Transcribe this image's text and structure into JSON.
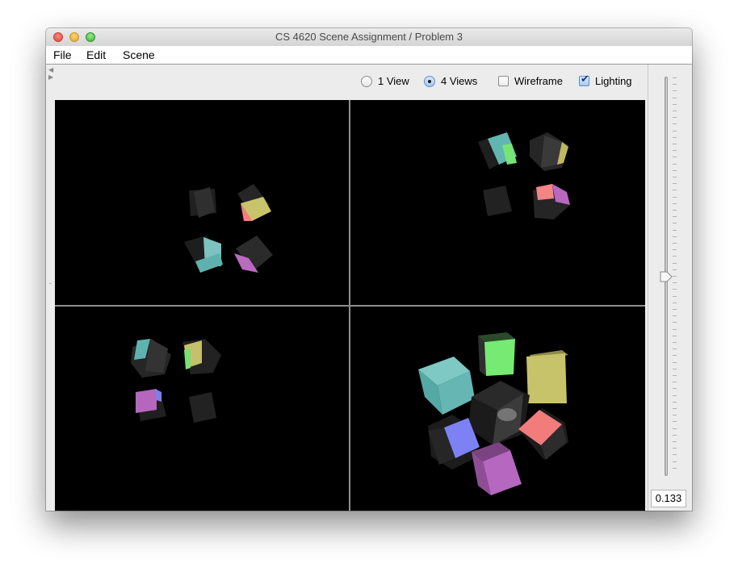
{
  "window": {
    "title": "CS 4620 Scene Assignment / Problem 3"
  },
  "menu": {
    "items": [
      "File",
      "Edit",
      "Scene"
    ]
  },
  "view_controls": {
    "one_view": {
      "label": "1 View",
      "selected": false
    },
    "four_views": {
      "label": "4 Views",
      "selected": true
    },
    "wireframe": {
      "label": "Wireframe",
      "checked": false
    },
    "lighting": {
      "label": "Lighting",
      "checked": true
    }
  },
  "slider": {
    "value": "0.133",
    "level_fraction": 0.5
  },
  "colors": {
    "viewport_bg": "#000000",
    "divider": "#8e8e8e",
    "cube_teal": "#5bb7b3",
    "cube_green": "#7de87b",
    "cube_olive": "#c6c26a",
    "cube_blue": "#7b80f2",
    "cube_pink": "#f37c7c",
    "cube_purple": "#b565bd",
    "cube_dark": "#1c1c1c"
  }
}
